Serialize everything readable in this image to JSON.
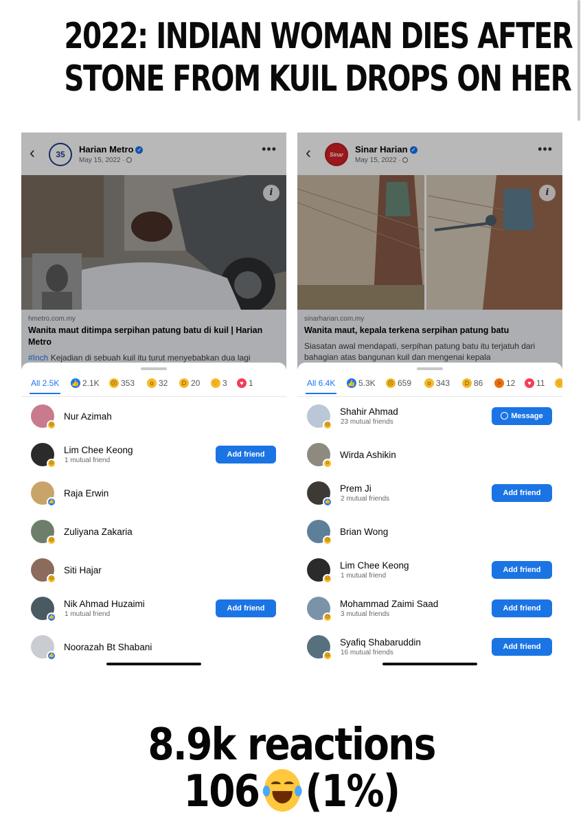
{
  "headline": {
    "line1": "2022: INDIAN WOMAN DIES AFTER",
    "line2": "STONE FROM KUIL DROPS ON HER"
  },
  "panels": [
    {
      "page_name": "Harian Metro",
      "date": "May 15, 2022 ·",
      "logo_text": "35",
      "link_domain": "hmetro.com.my",
      "link_title": "Wanita maut ditimpa serpihan patung batu di kuil | Harian Metro",
      "link_hashtag": "#Inch",
      "link_excerpt": " Kejadian di sebuah kuil itu turut menyebabkan dua lagi",
      "tabs": [
        {
          "type": "all",
          "label": "All 2.5K"
        },
        {
          "type": "like",
          "icon": "like-icon",
          "count": "2.1K"
        },
        {
          "type": "sad",
          "icon": "sad-icon",
          "count": "353"
        },
        {
          "type": "wow",
          "icon": "wow-icon",
          "count": "32"
        },
        {
          "type": "haha",
          "icon": "haha-icon",
          "count": "20"
        },
        {
          "type": "care",
          "icon": "care-icon",
          "count": "3"
        },
        {
          "type": "love",
          "icon": "love-icon",
          "count": "1"
        }
      ],
      "users": [
        {
          "name": "Nur Azimah",
          "sub": "",
          "reaction": "sad",
          "button": "",
          "avatar_color": "#c77b8d"
        },
        {
          "name": "Lim Chee Keong",
          "sub": "1 mutual friend",
          "reaction": "sad",
          "button": "Add friend",
          "avatar_color": "#2b2b2b"
        },
        {
          "name": "Raja Erwin",
          "sub": "",
          "reaction": "like",
          "button": "",
          "avatar_color": "#c9a46a"
        },
        {
          "name": "Zuliyana Zakaria",
          "sub": "",
          "reaction": "sad",
          "button": "",
          "avatar_color": "#6d7f6a"
        },
        {
          "name": "Siti Hajar",
          "sub": "",
          "reaction": "sad",
          "button": "",
          "avatar_color": "#8a6b5c"
        },
        {
          "name": "Nik Ahmad Huzaimi",
          "sub": "1 mutual friend",
          "reaction": "like",
          "button": "Add friend",
          "avatar_color": "#4a5a62"
        },
        {
          "name": "Noorazah Bt Shabani",
          "sub": "",
          "reaction": "like",
          "button": "",
          "avatar_color": "#c9ccd1"
        }
      ]
    },
    {
      "page_name": "Sinar Harian",
      "date": "May 15, 2022 ·",
      "logo_text": "Sinar",
      "link_domain": "sinarharian.com.my",
      "link_title": "Wanita maut, kepala terkena serpihan patung batu",
      "link_hashtag": "",
      "link_excerpt": "Siasatan awal mendapati, serpihan patung batu itu terjatuh dari bahagian atas bangunan kuil dan mengenai kepala",
      "tabs": [
        {
          "type": "all",
          "label": "All 6.4K"
        },
        {
          "type": "like",
          "icon": "like-icon",
          "count": "5.3K"
        },
        {
          "type": "sad",
          "icon": "sad-icon",
          "count": "659"
        },
        {
          "type": "wow",
          "icon": "wow-icon",
          "count": "343"
        },
        {
          "type": "haha",
          "icon": "haha-icon",
          "count": "86"
        },
        {
          "type": "angry",
          "icon": "angry-icon",
          "count": "12"
        },
        {
          "type": "love",
          "icon": "love-icon",
          "count": "11"
        },
        {
          "type": "care",
          "icon": "care-icon",
          "count": ""
        }
      ],
      "users": [
        {
          "name": "Shahir Ahmad",
          "sub": "23 mutual friends",
          "reaction": "sad",
          "button": "Message",
          "avatar_color": "#b9c7d6"
        },
        {
          "name": "Wirda Ashikin",
          "sub": "",
          "reaction": "wow",
          "button": "",
          "avatar_color": "#8f8a7f"
        },
        {
          "name": "Prem Ji",
          "sub": "2 mutual friends",
          "reaction": "like",
          "button": "Add friend",
          "avatar_color": "#3d3a35"
        },
        {
          "name": "Brian Wong",
          "sub": "",
          "reaction": "sad",
          "button": "",
          "avatar_color": "#5e7f9a"
        },
        {
          "name": "Lim Chee Keong",
          "sub": "1 mutual friend",
          "reaction": "sad",
          "button": "Add friend",
          "avatar_color": "#2b2b2b"
        },
        {
          "name": "Mohammad Zaimi Saad",
          "sub": "3 mutual friends",
          "reaction": "sad",
          "button": "Add friend",
          "avatar_color": "#7a93a8"
        },
        {
          "name": "Syafiq Shabaruddin",
          "sub": "16 mutual friends",
          "reaction": "sad",
          "button": "Add friend",
          "avatar_color": "#56707e"
        }
      ]
    }
  ],
  "footer": {
    "line1": "8.9k reactions",
    "line2_left": "106",
    "line2_right": "(1%)"
  },
  "colors": {
    "facebook_blue": "#1877f2",
    "button_blue": "#1b74e4"
  }
}
